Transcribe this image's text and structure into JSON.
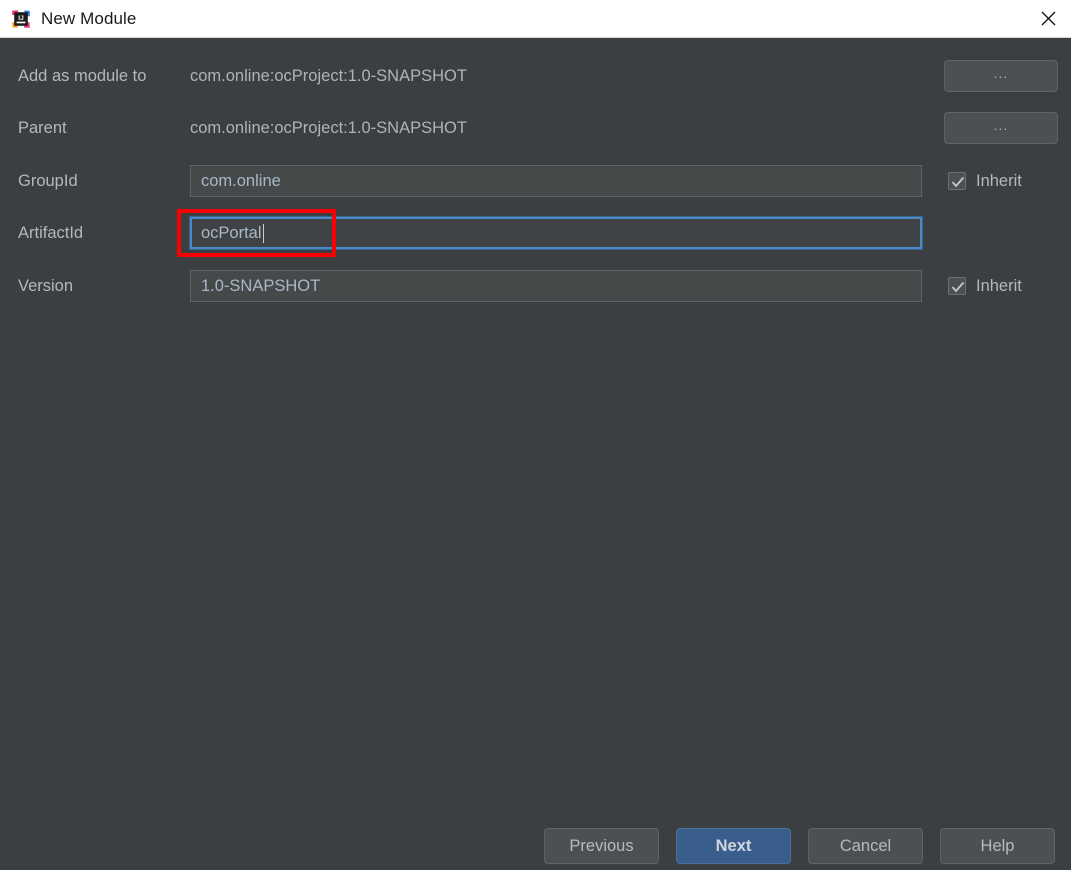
{
  "window": {
    "title": "New Module",
    "app_icon": "intellij-idea-logo-icon",
    "close_icon": "close-icon"
  },
  "form": {
    "rows": [
      {
        "label": "Add as module to",
        "value": "com.online:ocProject:1.0-SNAPSHOT",
        "kind": "static",
        "browse_label": "..."
      },
      {
        "label": "Parent",
        "value": "com.online:ocProject:1.0-SNAPSHOT",
        "kind": "static",
        "browse_label": "..."
      },
      {
        "label": "GroupId",
        "value": "com.online",
        "kind": "textfield",
        "inherit_label": "Inherit",
        "inherit_checked": true
      },
      {
        "label": "ArtifactId",
        "value": "ocPortal",
        "kind": "textfield",
        "focused": true
      },
      {
        "label": "Version",
        "value": "1.0-SNAPSHOT",
        "kind": "textfield",
        "inherit_label": "Inherit",
        "inherit_checked": true
      }
    ]
  },
  "footer": {
    "previous_label": "Previous",
    "next_label": "Next",
    "cancel_label": "Cancel",
    "help_label": "Help"
  },
  "colors": {
    "background": "#3c3f41",
    "titlebar": "#ffffff",
    "field_background": "#45494a",
    "focus_border": "#4a88c7",
    "default_button": "#3a5e8c",
    "annotation": "#fa0000",
    "text": "#b5b8ba",
    "field_text": "#a9b7c6"
  }
}
